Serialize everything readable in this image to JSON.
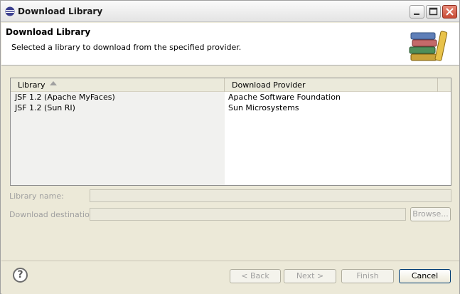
{
  "window": {
    "title": "Download Library"
  },
  "banner": {
    "title": "Download Library",
    "description": "Selected a library to download from the specified provider."
  },
  "table": {
    "columns": [
      "Library",
      "Download Provider"
    ],
    "sort_column": "Library",
    "rows": [
      [
        "JSF 1.2 (Apache MyFaces)",
        "Apache Software Foundation"
      ],
      [
        "JSF 1.2 (Sun RI)",
        "Sun Microsystems"
      ]
    ]
  },
  "form": {
    "library_name_label": "Library name:",
    "library_name_value": "",
    "destination_label": "Download destination:",
    "destination_value": "",
    "browse_label": "Browse..."
  },
  "buttons": {
    "back": "< Back",
    "next": "Next >",
    "finish": "Finish",
    "cancel": "Cancel"
  },
  "icons": {
    "help": "help-icon",
    "books": "books-icon"
  },
  "colors": {
    "dialog_bg": "#ece9d8",
    "close_button": "#c84b35",
    "default_button_border": "#003c74"
  }
}
